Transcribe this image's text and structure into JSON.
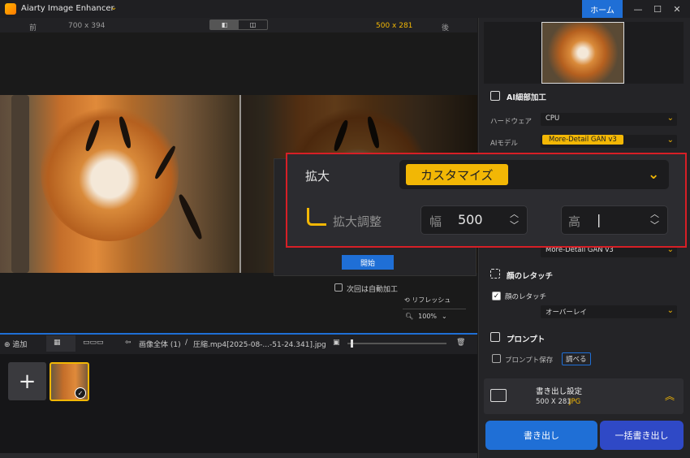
{
  "app": {
    "title": "Aiarty Image Enhancer",
    "home_label": "ホーム"
  },
  "window": {
    "min": "—",
    "max": "☐",
    "close": "✕"
  },
  "compare": {
    "before_label": "前",
    "before_size": "700 x 394",
    "after_size": "500 x 281",
    "after_label": "後",
    "mode_a": "◧",
    "mode_b": "◫"
  },
  "dialog": {
    "start_label": "開始",
    "auto_label": "次回は自動加工"
  },
  "view": {
    "refresh_label": "リフレッシュ",
    "zoom": "100%"
  },
  "bottombar": {
    "add_label": "追加",
    "breadcrumb_all": "画像全体 (1)",
    "separator": "/",
    "filename": "圧縮.mp4[2025-08-...-51-24.341].jpg"
  },
  "thumbs": {
    "add_symbol": "+"
  },
  "right": {
    "ai_section": "AI細部加工",
    "hardware_label": "ハードウェア",
    "hardware_value": "CPU",
    "model_label": "AIモデル",
    "model_value": "More-Detail GAN  v3",
    "model_value2": "More-Detail GAN  v3",
    "face_section": "顔のレタッチ",
    "face_check_label": "顔のレタッチ",
    "overlay_value": "オーバーレイ",
    "prompt_section": "プロンプト",
    "prompt_save_label": "プロンプト保存",
    "prompt_check_btn": "調べる",
    "export_settings_title": "書き出し設定",
    "export_size": "500 X 281",
    "export_format": "JPG",
    "export_btn": "書き出し",
    "batch_btn": "一括書き出し"
  },
  "callout": {
    "scale_label": "拡大",
    "scale_value": "カスタマイズ",
    "adjust_label": "拡大調整",
    "width_label": "幅",
    "width_value": "500",
    "height_label": "高",
    "height_value": "|"
  },
  "colors": {
    "accent_yellow": "#f2b705",
    "accent_blue": "#1f6fd6",
    "batch_blue": "#2f49c6",
    "highlight_red": "#d71f26"
  }
}
